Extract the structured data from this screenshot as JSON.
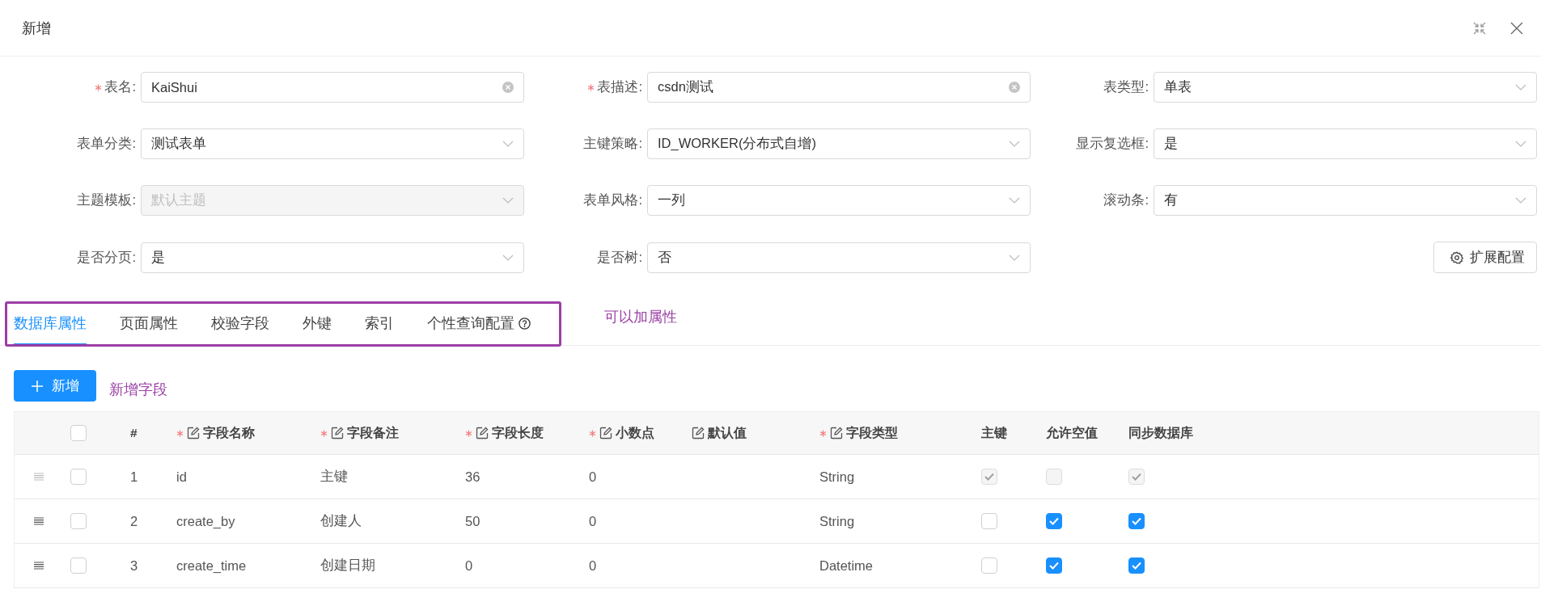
{
  "dialog": {
    "title": "新增"
  },
  "form": {
    "fields": [
      {
        "label": "表名:",
        "required": true,
        "kind": "input",
        "value": "KaiShui",
        "disabled": false
      },
      {
        "label": "表描述:",
        "required": true,
        "kind": "input",
        "value": "csdn测试",
        "disabled": false
      },
      {
        "label": "表类型:",
        "required": false,
        "kind": "select",
        "value": "单表",
        "disabled": false
      },
      {
        "label": "表单分类:",
        "required": false,
        "kind": "select",
        "value": "测试表单",
        "disabled": false
      },
      {
        "label": "主键策略:",
        "required": false,
        "kind": "select",
        "value": "ID_WORKER(分布式自增)",
        "disabled": false
      },
      {
        "label": "显示复选框:",
        "required": false,
        "kind": "select",
        "value": "是",
        "disabled": false
      },
      {
        "label": "主题模板:",
        "required": false,
        "kind": "select",
        "value": "默认主题",
        "disabled": true
      },
      {
        "label": "表单风格:",
        "required": false,
        "kind": "select",
        "value": "一列",
        "disabled": false
      },
      {
        "label": "滚动条:",
        "required": false,
        "kind": "select",
        "value": "有",
        "disabled": false
      },
      {
        "label": "是否分页:",
        "required": false,
        "kind": "select",
        "value": "是",
        "disabled": false
      },
      {
        "label": "是否树:",
        "required": false,
        "kind": "select",
        "value": "否",
        "disabled": false
      }
    ],
    "extend_button": {
      "label": "扩展配置"
    }
  },
  "tabs": {
    "items": [
      {
        "label": "数据库属性",
        "selected": true,
        "help": false
      },
      {
        "label": "页面属性",
        "selected": false,
        "help": false
      },
      {
        "label": "校验字段",
        "selected": false,
        "help": false
      },
      {
        "label": "外键",
        "selected": false,
        "help": false
      },
      {
        "label": "索引",
        "selected": false,
        "help": false
      },
      {
        "label": "个性查询配置",
        "selected": false,
        "help": true
      }
    ],
    "note": "可以加属性"
  },
  "toolbar": {
    "add_button": {
      "label": "新增"
    },
    "note": "新增字段"
  },
  "table": {
    "select_all": {
      "checked": false
    },
    "columns": [
      {
        "label": "#",
        "kind": "text",
        "required": false,
        "editable": false
      },
      {
        "label": "字段名称",
        "kind": "text",
        "required": true,
        "editable": true
      },
      {
        "label": "字段备注",
        "kind": "text",
        "required": true,
        "editable": true
      },
      {
        "label": "字段长度",
        "kind": "text",
        "required": true,
        "editable": true
      },
      {
        "label": "小数点",
        "kind": "text",
        "required": true,
        "editable": true
      },
      {
        "label": "默认值",
        "kind": "text",
        "required": false,
        "editable": true
      },
      {
        "label": "字段类型",
        "kind": "text",
        "required": true,
        "editable": true
      },
      {
        "label": "主键",
        "kind": "check",
        "required": false,
        "editable": false
      },
      {
        "label": "允许空值",
        "kind": "check",
        "required": false,
        "editable": false
      },
      {
        "label": "同步数据库",
        "kind": "check",
        "required": false,
        "editable": false
      }
    ],
    "rows": [
      {
        "drag_disabled": true,
        "selected": false,
        "index": "1",
        "name": "id",
        "remark": "主键",
        "length": "36",
        "decimal": "0",
        "type": "String",
        "pk": {
          "checked": true,
          "disabled": true
        },
        "nullable": {
          "checked": false,
          "disabled": true
        },
        "sync": {
          "checked": true,
          "disabled": true
        }
      },
      {
        "drag_disabled": false,
        "selected": false,
        "index": "2",
        "name": "create_by",
        "remark": "创建人",
        "length": "50",
        "decimal": "0",
        "type": "String",
        "pk": {
          "checked": false,
          "disabled": false
        },
        "nullable": {
          "checked": true,
          "disabled": false
        },
        "sync": {
          "checked": true,
          "disabled": false
        }
      },
      {
        "drag_disabled": false,
        "selected": false,
        "index": "3",
        "name": "create_time",
        "remark": "创建日期",
        "length": "0",
        "decimal": "0",
        "type": "Datetime",
        "pk": {
          "checked": false,
          "disabled": false
        },
        "nullable": {
          "checked": true,
          "disabled": false
        },
        "sync": {
          "checked": true,
          "disabled": false
        }
      }
    ]
  }
}
